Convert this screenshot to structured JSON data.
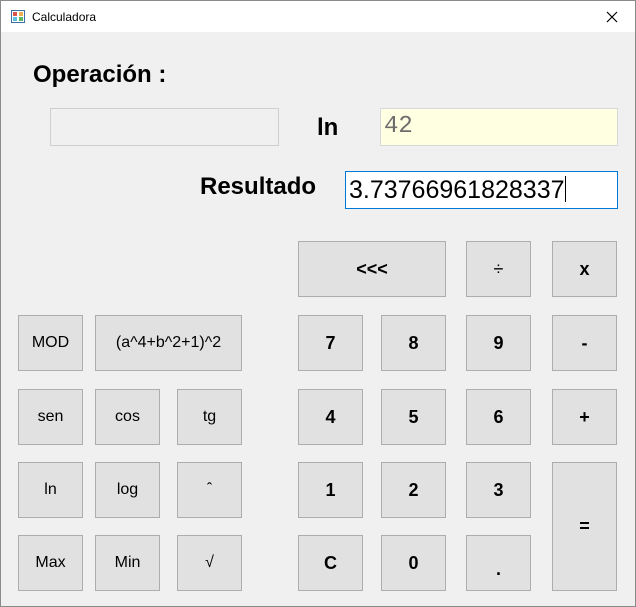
{
  "window": {
    "title": "Calculadora",
    "close_label": "✕"
  },
  "labels": {
    "operacion": "Operación :",
    "current_op": "ln",
    "resultado": "Resultado"
  },
  "fields": {
    "operation_value": "",
    "input_value": "42",
    "result_value": "3.73766961828337"
  },
  "buttons": {
    "backspace": "<<<",
    "divide": "÷",
    "multiply": "x",
    "mod": "MOD",
    "formula": "(a^4+b^2+1)^2",
    "seven": "7",
    "eight": "8",
    "nine": "9",
    "minus": "-",
    "sen": "sen",
    "cos": "cos",
    "tg": "tg",
    "four": "4",
    "five": "5",
    "six": "6",
    "plus": "+",
    "ln": "ln",
    "log": "log",
    "power": "ˆ",
    "one": "1",
    "two": "2",
    "three": "3",
    "equals": "=",
    "max": "Max",
    "min": "Min",
    "sqrt": "√",
    "clear": "C",
    "zero": "0",
    "dot": "."
  },
  "colors": {
    "input_bg": "#ffffe1",
    "input_text": "#6d6d6d",
    "result_border": "#0078d7"
  }
}
